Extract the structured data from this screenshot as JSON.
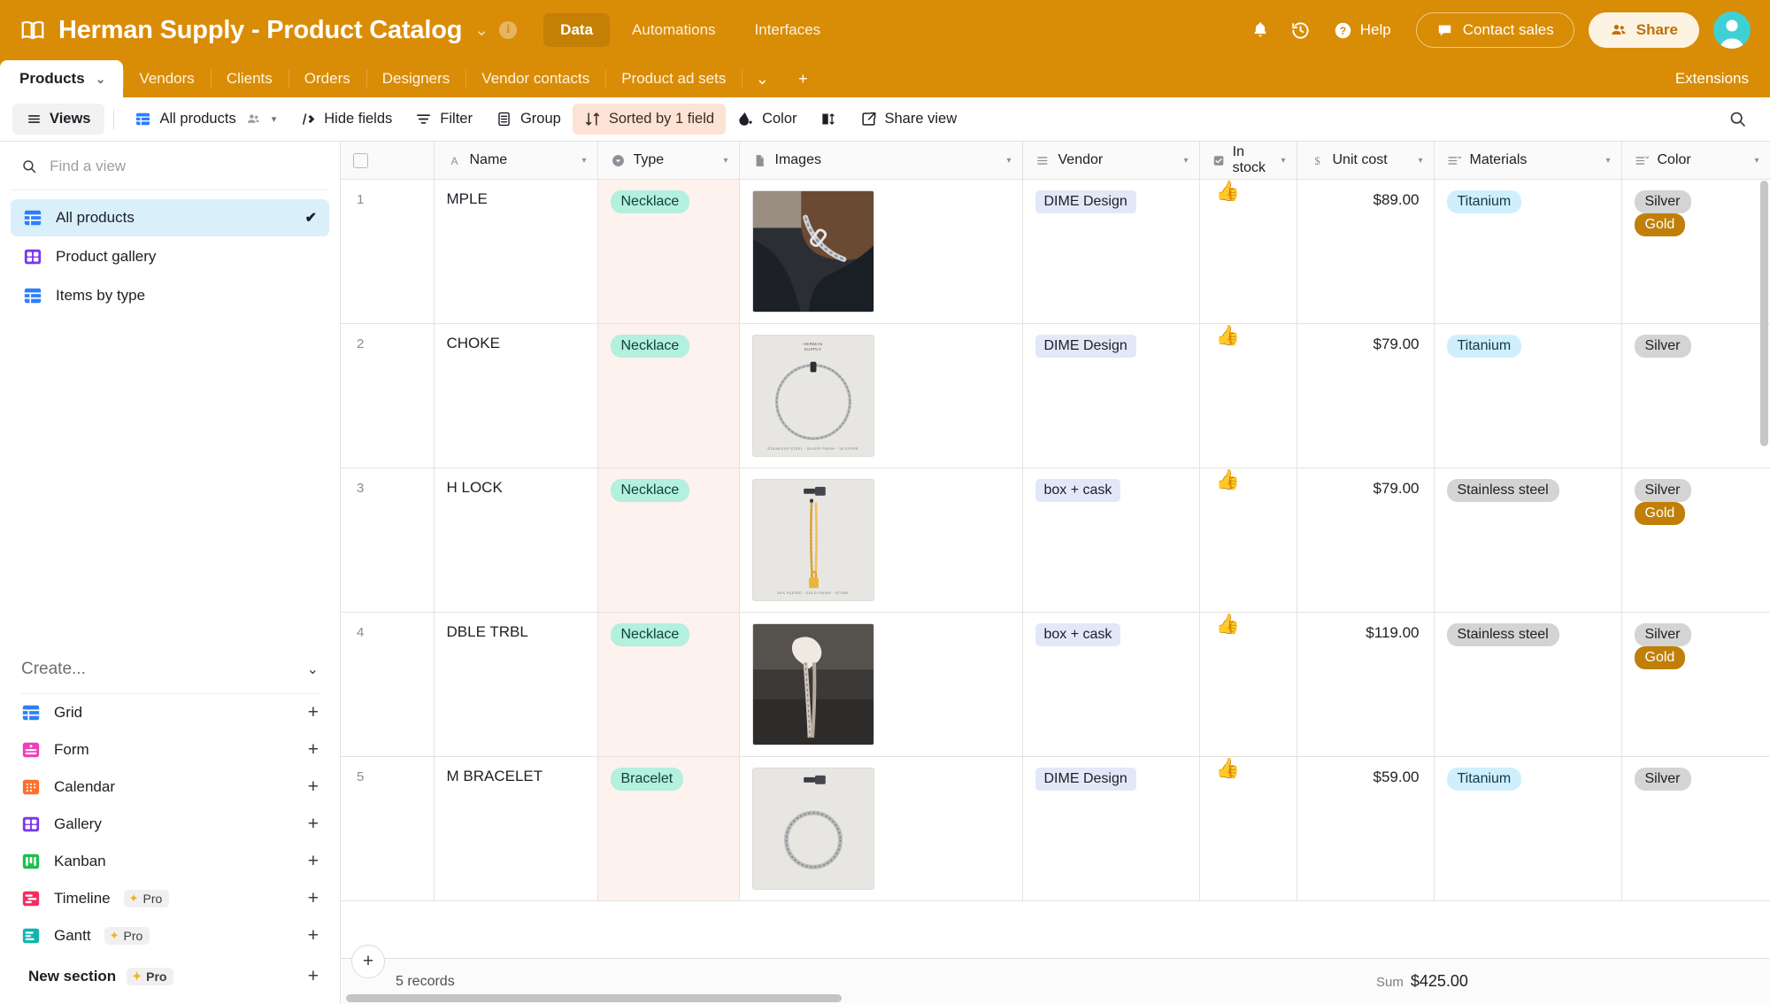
{
  "header": {
    "book_icon": "book-icon",
    "title": "Herman Supply - Product Catalog",
    "title_caret": "⌄",
    "info_icon": "i",
    "mode_tabs": [
      {
        "label": "Data",
        "active": true
      },
      {
        "label": "Automations",
        "active": false
      },
      {
        "label": "Interfaces",
        "active": false
      }
    ],
    "notification_icon": "bell-icon",
    "history_icon": "history-icon",
    "help_label": "Help",
    "contact_sales_label": "Contact sales",
    "share_label": "Share",
    "brand_color": "#d98c06",
    "avatar_color": "#3fd0d4"
  },
  "table_tabs": {
    "active": "Products",
    "active_caret": "⌄",
    "others": [
      "Vendors",
      "Clients",
      "Orders",
      "Designers",
      "Vendor contacts",
      "Product ad sets"
    ],
    "overflow_caret": "⌄",
    "add_tab": "+",
    "extensions_label": "Extensions"
  },
  "toolbar": {
    "views_label": "Views",
    "current_view": "All products",
    "view_caret": "▾",
    "hide_fields_label": "Hide fields",
    "filter_label": "Filter",
    "group_label": "Group",
    "sorted_label": "Sorted by 1 field",
    "color_label": "Color",
    "row_height_icon": "row-height-icon",
    "share_view_label": "Share view",
    "search_icon": "search-icon",
    "sorted_bg": "#fde3d4"
  },
  "sidebar": {
    "search_placeholder": "Find a view",
    "search_value": "",
    "views": [
      {
        "label": "All products",
        "icon": "grid-view-icon",
        "color": "#2d7ff9",
        "active": true,
        "check": "✔"
      },
      {
        "label": "Product gallery",
        "icon": "gallery-view-icon",
        "color": "#7c37ef",
        "active": false
      },
      {
        "label": "Items by type",
        "icon": "grid-view-icon",
        "color": "#2d7ff9",
        "active": false
      }
    ],
    "create_label": "Create...",
    "create_chevron": "⌄",
    "create_items": [
      {
        "label": "Grid",
        "icon": "grid-icon",
        "color": "#2d7ff9",
        "pro": false,
        "plus": "+"
      },
      {
        "label": "Form",
        "icon": "form-icon",
        "color": "#ef3dbe",
        "pro": false,
        "plus": "+"
      },
      {
        "label": "Calendar",
        "icon": "calendar-icon",
        "color": "#ff6f2c",
        "pro": false,
        "plus": "+"
      },
      {
        "label": "Gallery",
        "icon": "gallery-icon",
        "color": "#7c37ef",
        "pro": false,
        "plus": "+"
      },
      {
        "label": "Kanban",
        "icon": "kanban-icon",
        "color": "#1bbf4c",
        "pro": false,
        "plus": "+"
      },
      {
        "label": "Timeline",
        "icon": "timeline-icon",
        "color": "#f82b60",
        "pro": true,
        "pro_label": "Pro",
        "plus": "+"
      },
      {
        "label": "Gantt",
        "icon": "gantt-icon",
        "color": "#12b5ab",
        "pro": true,
        "pro_label": "Pro",
        "plus": "+"
      }
    ],
    "new_section_label": "New section",
    "new_section_pro": "Pro",
    "new_section_plus": "+"
  },
  "grid": {
    "select_all_checkbox": "",
    "columns": [
      {
        "label": "Name",
        "icon": "text-field-icon",
        "caret": "▾"
      },
      {
        "label": "Type",
        "icon": "single-select-icon",
        "caret": "▾"
      },
      {
        "label": "Images",
        "icon": "attachment-icon",
        "caret": "▾"
      },
      {
        "label": "Vendor",
        "icon": "multi-select-icon",
        "caret": "▾"
      },
      {
        "label": "In stock",
        "icon": "checkbox-field-icon",
        "caret": "▾"
      },
      {
        "label": "Unit cost",
        "icon": "currency-icon",
        "caret": "▾"
      },
      {
        "label": "Materials",
        "icon": "multi-select-icon",
        "caret": "▾"
      },
      {
        "label": "Color",
        "icon": "multi-select-icon",
        "caret": "▾"
      }
    ],
    "rows": [
      {
        "num": "1",
        "name": "MPLE",
        "type": "Necklace",
        "image": "necklace-on-model-dark-tshirt",
        "vendor": "DIME Design",
        "in_stock": "👍",
        "unit_cost": "$89.00",
        "materials": [
          "Titanium"
        ],
        "colors": [
          "Silver",
          "Gold"
        ]
      },
      {
        "num": "2",
        "name": "CHOKE",
        "type": "Necklace",
        "image": "silver-choker-product-shot",
        "vendor": "DIME Design",
        "in_stock": "👍",
        "unit_cost": "$79.00",
        "materials": [
          "Titanium"
        ],
        "colors": [
          "Silver"
        ]
      },
      {
        "num": "3",
        "name": "H LOCK",
        "type": "Necklace",
        "image": "gold-chain-lock-product-shot",
        "vendor": "box + cask",
        "in_stock": "👍",
        "unit_cost": "$79.00",
        "materials": [
          "Stainless steel"
        ],
        "colors": [
          "Silver",
          "Gold"
        ]
      },
      {
        "num": "4",
        "name": "DBLE TRBL",
        "type": "Necklace",
        "image": "hand-holding-chains-dark",
        "vendor": "box + cask",
        "in_stock": "👍",
        "unit_cost": "$119.00",
        "materials": [
          "Stainless steel"
        ],
        "colors": [
          "Silver",
          "Gold"
        ]
      },
      {
        "num": "5",
        "name": "M BRACELET",
        "type": "Bracelet",
        "image": "silver-bracelet-product-shot",
        "vendor": "DIME Design",
        "in_stock": "👍",
        "unit_cost": "$59.00",
        "materials": [
          "Titanium"
        ],
        "colors": [
          "Silver"
        ]
      }
    ],
    "thumb_brand_text": "HERMAN\nSUPPLY",
    "thumb_caption_text": "STAINLESS STEEL · SILVER FINISH · 18 STORE",
    "add_record": "+",
    "record_count": "5 records",
    "sum_label": "Sum",
    "sum_value": "$425.00"
  }
}
